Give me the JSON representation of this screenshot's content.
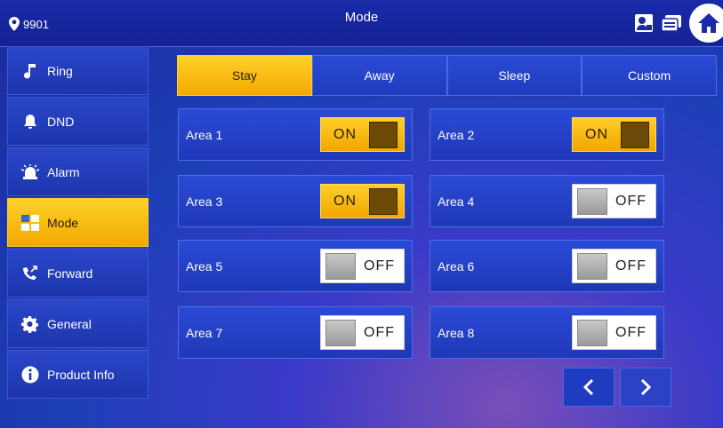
{
  "header": {
    "location_number": "9901",
    "title": "Mode"
  },
  "sidebar": {
    "items": [
      {
        "label": "Ring",
        "icon": "music-note-icon"
      },
      {
        "label": "DND",
        "icon": "bell-icon"
      },
      {
        "label": "Alarm",
        "icon": "siren-icon"
      },
      {
        "label": "Mode",
        "icon": "mode-grid-icon",
        "active": true
      },
      {
        "label": "Forward",
        "icon": "call-forward-icon"
      },
      {
        "label": "General",
        "icon": "gear-icon"
      },
      {
        "label": "Product Info",
        "icon": "info-icon"
      }
    ]
  },
  "tabs": [
    {
      "label": "Stay",
      "active": true
    },
    {
      "label": "Away"
    },
    {
      "label": "Sleep"
    },
    {
      "label": "Custom"
    }
  ],
  "areas": [
    {
      "label": "Area 1",
      "state": "ON"
    },
    {
      "label": "Area 2",
      "state": "ON"
    },
    {
      "label": "Area 3",
      "state": "ON"
    },
    {
      "label": "Area 4",
      "state": "OFF"
    },
    {
      "label": "Area 5",
      "state": "OFF"
    },
    {
      "label": "Area 6",
      "state": "OFF"
    },
    {
      "label": "Area 7",
      "state": "OFF"
    },
    {
      "label": "Area 8",
      "state": "OFF"
    }
  ],
  "colors": {
    "accent": "#f7b800",
    "panel": "#2442c8",
    "background": "#1a2a9a"
  }
}
